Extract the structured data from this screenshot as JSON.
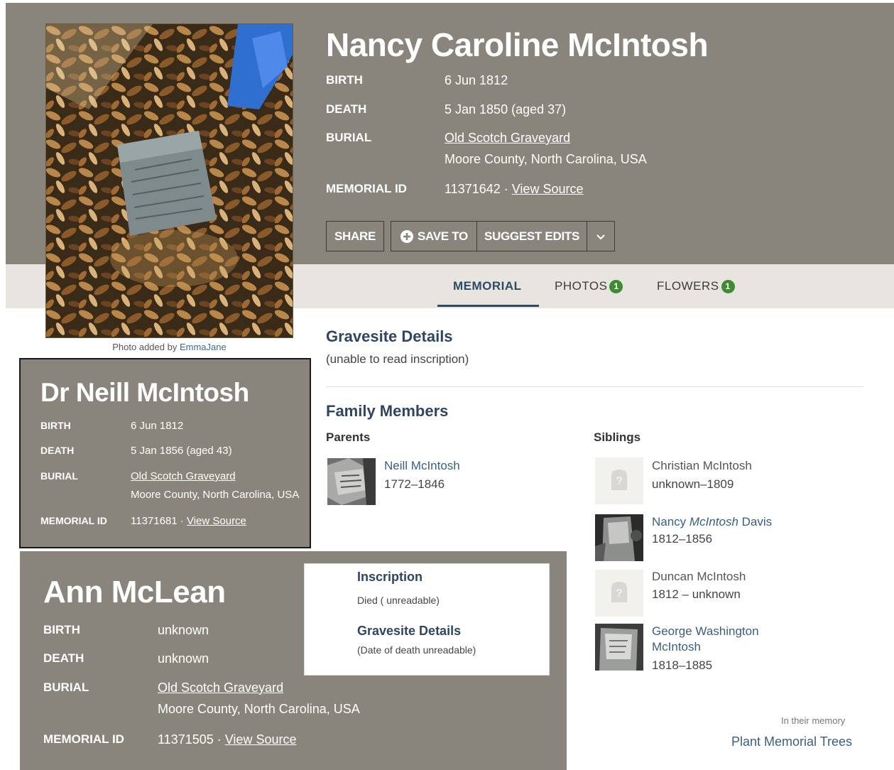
{
  "main": {
    "name": "Nancy Caroline McIntosh",
    "facts": {
      "birth_label": "BIRTH",
      "birth": "6 Jun 1812",
      "death_label": "DEATH",
      "death": "5 Jan 1850 (aged 37)",
      "burial_label": "BURIAL",
      "burial_place": "Old Scotch Graveyard",
      "burial_location": "Moore County, North Carolina, USA",
      "memorial_label": "MEMORIAL ID",
      "memorial_id": "11371642",
      "sep": " · ",
      "view_source": "View Source"
    },
    "actions": {
      "share": "SHARE",
      "save_to": "SAVE TO",
      "suggest_edits": "SUGGEST EDITS"
    },
    "photo": {
      "prefix": "Photo added by ",
      "user": "EmmaJane"
    },
    "tabs": [
      {
        "label": "MEMORIAL",
        "active": true
      },
      {
        "label": "PHOTOS",
        "count": "1"
      },
      {
        "label": "FLOWERS",
        "count": "1"
      }
    ],
    "gravesite": {
      "title": "Gravesite Details",
      "text": "(unable to read inscription)"
    },
    "family": {
      "title": "Family Members",
      "parents_label": "Parents",
      "siblings_label": "Siblings",
      "parents": [
        {
          "name": "Neill McIntosh",
          "dates": "1772–1846"
        }
      ],
      "siblings": [
        {
          "name": "Christian McIntosh",
          "dates": "unknown–1809"
        },
        {
          "first": "Nancy ",
          "maiden": "McIntosh",
          "last": " Davis",
          "dates": "1812–1856"
        },
        {
          "name": "Duncan McIntosh",
          "dates": "1812 – unknown"
        },
        {
          "name_line1": "George Washington",
          "name_line2": "McIntosh",
          "dates": "1818–1885"
        }
      ]
    },
    "memory": {
      "label": "In their memory",
      "link": "Plant Memorial Trees"
    }
  },
  "neill": {
    "name": "Dr Neill McIntosh",
    "birth_label": "BIRTH",
    "birth": "6 Jun 1812",
    "death_label": "DEATH",
    "death": "5 Jan 1856 (aged 43)",
    "burial_label": "BURIAL",
    "burial_place": "Old Scotch Graveyard",
    "burial_location": "Moore County, North Carolina, USA",
    "memorial_label": "MEMORIAL ID",
    "memorial_id": "11371681",
    "sep": " · ",
    "view_source": "View Source"
  },
  "ann": {
    "name": "Ann McLean",
    "birth_label": "BIRTH",
    "birth": "unknown",
    "death_label": "DEATH",
    "death": "unknown",
    "burial_label": "BURIAL",
    "burial_place": "Old Scotch Graveyard",
    "burial_location": "Moore County, North Carolina, USA",
    "memorial_label": "MEMORIAL ID",
    "memorial_id": "11371505",
    "sep": " · ",
    "view_source": "View Source",
    "inscription_title": "Inscription",
    "inscription_text": "Died ( unreadable)",
    "gravesite_title": "Gravesite Details",
    "gravesite_text": "(Date of death unreadable)"
  },
  "colors": {
    "hero_bg": "#8a857c",
    "tabbar_bg": "#e8e5e1",
    "link": "#3b5e80",
    "badge": "#3f8a32"
  },
  "icons": {
    "save": "plus-circle-icon",
    "more": "chevron-down-icon",
    "placeholder": "headstone-placeholder-icon"
  }
}
